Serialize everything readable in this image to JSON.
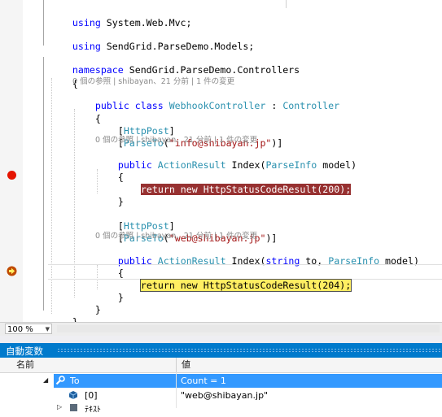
{
  "editor": {
    "lines": {
      "l1": {
        "kw": "using",
        "rest": " System.Web.Mvc;"
      },
      "l2": {
        "kw": "using",
        "rest": " SendGrid.ParseDemo.Models;"
      },
      "l3": {
        "kw": "namespace",
        "rest": " SendGrid.ParseDemo.Controllers"
      },
      "l4": "{",
      "lens1": "0 個の参照 | shibayan、21 分前 | 1 件の変更",
      "l5": {
        "kw1": "public",
        "kw2": "class",
        "type1": "WebhookController",
        "sep": " : ",
        "type2": "Controller"
      },
      "l6": "{",
      "l7": {
        "open": "[",
        "attr": "HttpPost",
        "close": "]"
      },
      "l8": {
        "open": "[",
        "attr": "ParseTo",
        "arg": "\"info@shibayan.jp\"",
        "close": ")]"
      },
      "lens2": "0 個の参照 | shibayan、21 分前 | 1 件の変更",
      "l9": {
        "kw": "public",
        "type1": "ActionResult",
        "method": " Index(",
        "type2": "ParseInfo",
        "rest": " model)"
      },
      "l10": "{",
      "l11": "return new HttpStatusCodeResult(200);",
      "l12": "}",
      "l13": {
        "open": "[",
        "attr": "HttpPost",
        "close": "]"
      },
      "l14": {
        "open": "[",
        "attr": "ParseTo",
        "arg": "\"web@shibayan.jp\"",
        "close": ")]"
      },
      "lens3": "0 個の参照 | shibayan、21 分前 | 1 件の変更",
      "l15": {
        "kw": "public",
        "type1": "ActionResult",
        "method": " Index(",
        "kw2": "string",
        "mid": " to, ",
        "type2": "ParseInfo",
        "rest": " model)"
      },
      "l16": "{",
      "l17": "return new HttpStatusCodeResult(204);",
      "l18": "}",
      "l19": "}",
      "l20": "}"
    }
  },
  "zoom": {
    "value": "100 %"
  },
  "autos_window": {
    "title": "自動変数",
    "columns": {
      "name": "名前",
      "value": "値"
    },
    "rows": [
      {
        "name": "To",
        "value": "Count = 1"
      },
      {
        "name": "[0]",
        "value": "\"web@shibayan.jp\""
      },
      {
        "name": "ﾃｷｽﾄ",
        "value": ""
      }
    ]
  },
  "colors": {
    "breakpoint": "#e51400",
    "breakpoint_highlight": "#973131",
    "current_statement": "#ffee62",
    "tool_window_title": "#007acc",
    "selection": "#3399ff"
  },
  "icons": [
    "breakpoint-icon",
    "current-statement-arrow-icon",
    "wrench-property-icon",
    "field-cube-icon",
    "expand-triangle-icon"
  ]
}
